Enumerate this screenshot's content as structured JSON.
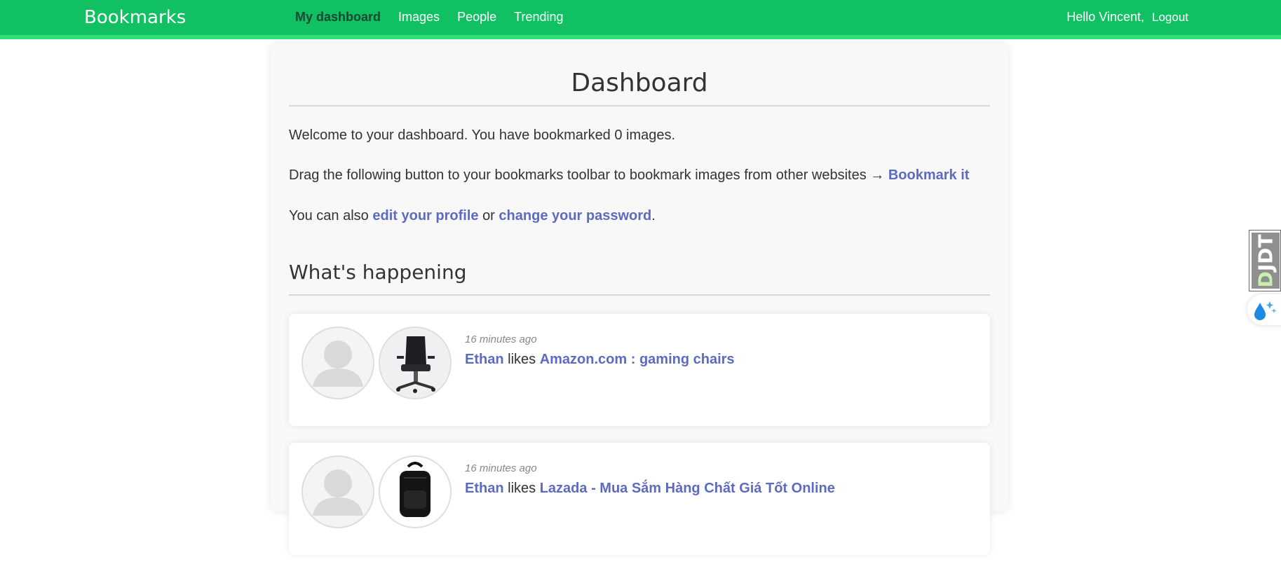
{
  "header": {
    "brand": "Bookmarks",
    "nav": [
      {
        "label": "My dashboard",
        "active": true
      },
      {
        "label": "Images",
        "active": false
      },
      {
        "label": "People",
        "active": false
      },
      {
        "label": "Trending",
        "active": false
      }
    ],
    "greeting": "Hello Vincent,",
    "logout": "Logout"
  },
  "main": {
    "title": "Dashboard",
    "welcome": "Welcome to your dashboard. You have bookmarked 0 images.",
    "drag_text": "Drag the following button to your bookmarks toolbar to bookmark images from other websites →",
    "bookmark_link": "Bookmark it",
    "also_prefix": "You can also",
    "edit_profile_link": "edit your profile",
    "or_text": "or",
    "change_password_link": "change your password",
    "period": ".",
    "section_title": "What's happening"
  },
  "actions": [
    {
      "time": "16 minutes ago",
      "user": "Ethan",
      "verb": "likes",
      "target": "Amazon.com : gaming chairs",
      "image_icon": "gaming-chair-thumbnail"
    },
    {
      "time": "16 minutes ago",
      "user": "Ethan",
      "verb": "likes",
      "target": "Lazada - Mua Sắm Hàng Chất Giá Tốt Online",
      "image_icon": "backpack-thumbnail"
    }
  ],
  "toolbar": {
    "djdt_label": "DJDT",
    "djdt_first": "D",
    "djdt_rest": "JDT"
  },
  "colors": {
    "header_green": "#12c064",
    "link_blue": "#5c6bc0",
    "active_nav": "#17492f"
  }
}
